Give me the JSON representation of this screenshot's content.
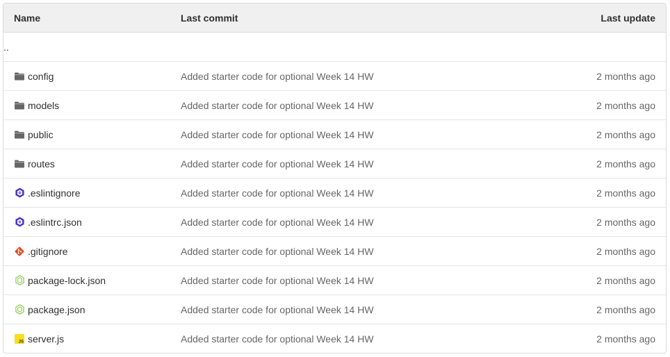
{
  "headers": {
    "name": "Name",
    "last_commit": "Last commit",
    "last_update": "Last update"
  },
  "parent_dir": "..",
  "rows": [
    {
      "name": "config",
      "icon": "folder-icon",
      "commit": "Added starter code for optional Week 14 HW",
      "updated": "2 months ago"
    },
    {
      "name": "models",
      "icon": "folder-icon",
      "commit": "Added starter code for optional Week 14 HW",
      "updated": "2 months ago"
    },
    {
      "name": "public",
      "icon": "folder-icon",
      "commit": "Added starter code for optional Week 14 HW",
      "updated": "2 months ago"
    },
    {
      "name": "routes",
      "icon": "folder-icon",
      "commit": "Added starter code for optional Week 14 HW",
      "updated": "2 months ago"
    },
    {
      "name": ".eslintignore",
      "icon": "eslint-icon",
      "commit": "Added starter code for optional Week 14 HW",
      "updated": "2 months ago"
    },
    {
      "name": ".eslintrc.json",
      "icon": "eslint-icon",
      "commit": "Added starter code for optional Week 14 HW",
      "updated": "2 months ago"
    },
    {
      "name": ".gitignore",
      "icon": "git-icon",
      "commit": "Added starter code for optional Week 14 HW",
      "updated": "2 months ago"
    },
    {
      "name": "package-lock.json",
      "icon": "nodejs-icon",
      "commit": "Added starter code for optional Week 14 HW",
      "updated": "2 months ago"
    },
    {
      "name": "package.json",
      "icon": "nodejs-icon",
      "commit": "Added starter code for optional Week 14 HW",
      "updated": "2 months ago"
    },
    {
      "name": "server.js",
      "icon": "javascript-icon",
      "commit": "Added starter code for optional Week 14 HW",
      "updated": "2 months ago"
    }
  ],
  "colors": {
    "folder": "#666666",
    "eslint": "#4b32c3",
    "git": "#e44d26",
    "nodejs": "#8cc84b",
    "javascript": "#f7df1e"
  }
}
